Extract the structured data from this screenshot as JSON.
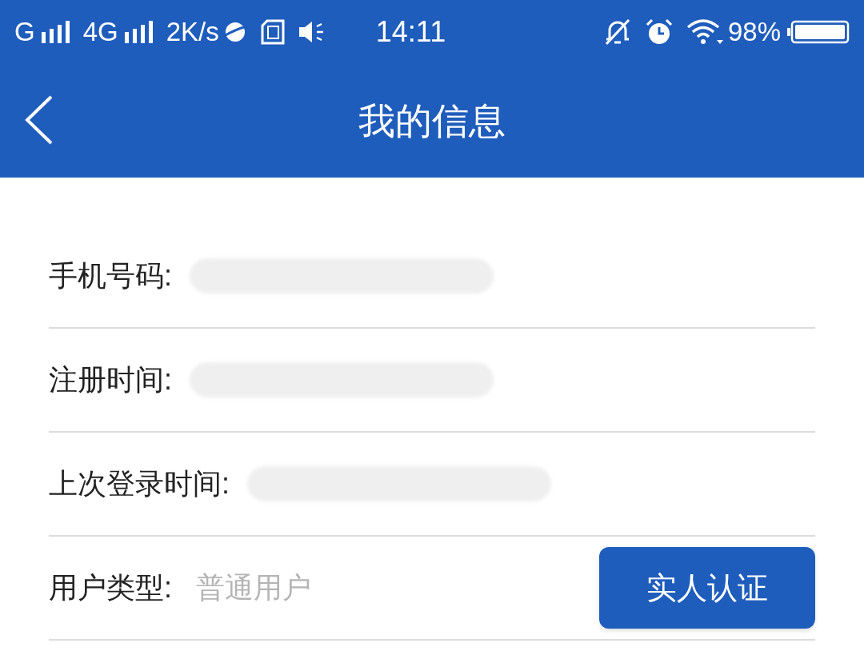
{
  "status_bar": {
    "carrier_1": "G",
    "carrier_2": "4G",
    "speed": "2K/s",
    "time": "14:11",
    "battery": "98%"
  },
  "header": {
    "title": "我的信息"
  },
  "rows": [
    {
      "label": "手机号码:",
      "redacted": true
    },
    {
      "label": "注册时间:",
      "redacted": true
    },
    {
      "label": "上次登录时间:",
      "redacted": true
    },
    {
      "label": "用户类型:",
      "value": "普通用户",
      "redacted": false,
      "button": "实人认证"
    }
  ]
}
